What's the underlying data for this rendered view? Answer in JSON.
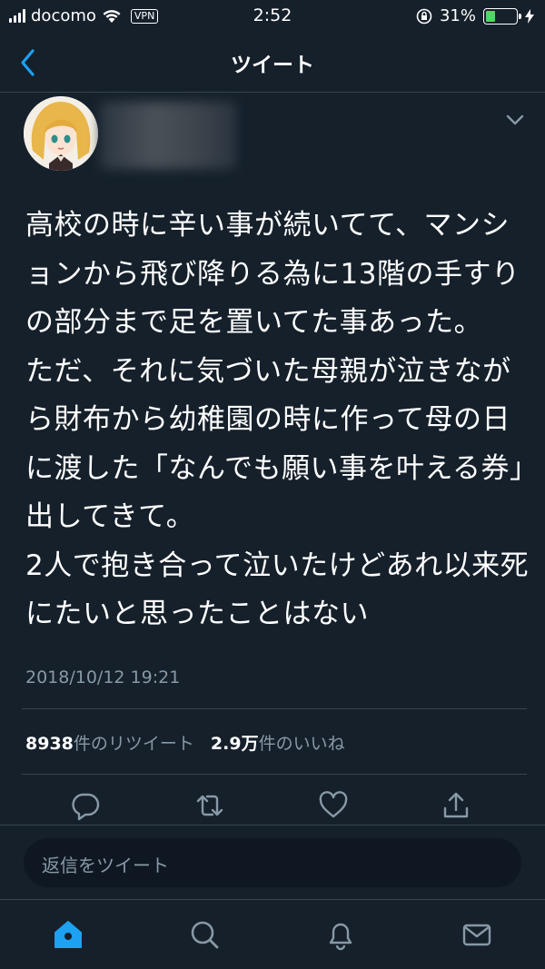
{
  "status_bar": {
    "carrier": "docomo",
    "vpn_label": "VPN",
    "time": "2:52",
    "battery_percent": "31%",
    "battery_level": 0.31
  },
  "nav": {
    "title": "ツイート",
    "back_icon": "chevron-left-icon"
  },
  "tweet": {
    "text": "高校の時に辛い事が続いてて、マンションから飛び降りる為に13階の手すりの部分まで足を置いてた事あった。\nただ、それに気づいた母親が泣きながら財布から幼稚園の時に作って母の日に渡した「なんでも願い事を叶える券」出してきて。\n2人で抱き合って泣いたけどあれ以来死にたいと思ったことはない",
    "timestamp": "2018/10/12 19:21"
  },
  "stats": {
    "retweet_count": "8938",
    "retweet_label": "件のリツイート",
    "like_count": "2.9万",
    "like_label": "件のいいね"
  },
  "actions": [
    "reply-icon",
    "retweet-icon",
    "like-icon",
    "share-icon"
  ],
  "reply": {
    "placeholder": "返信をツイート"
  },
  "tabs": [
    "home-icon",
    "search-icon",
    "notifications-icon",
    "messages-icon"
  ],
  "colors": {
    "background": "#15202b",
    "divider": "#38444d",
    "accent": "#1da1f2",
    "secondary_text": "#8899a6",
    "battery": "#4cd964"
  }
}
